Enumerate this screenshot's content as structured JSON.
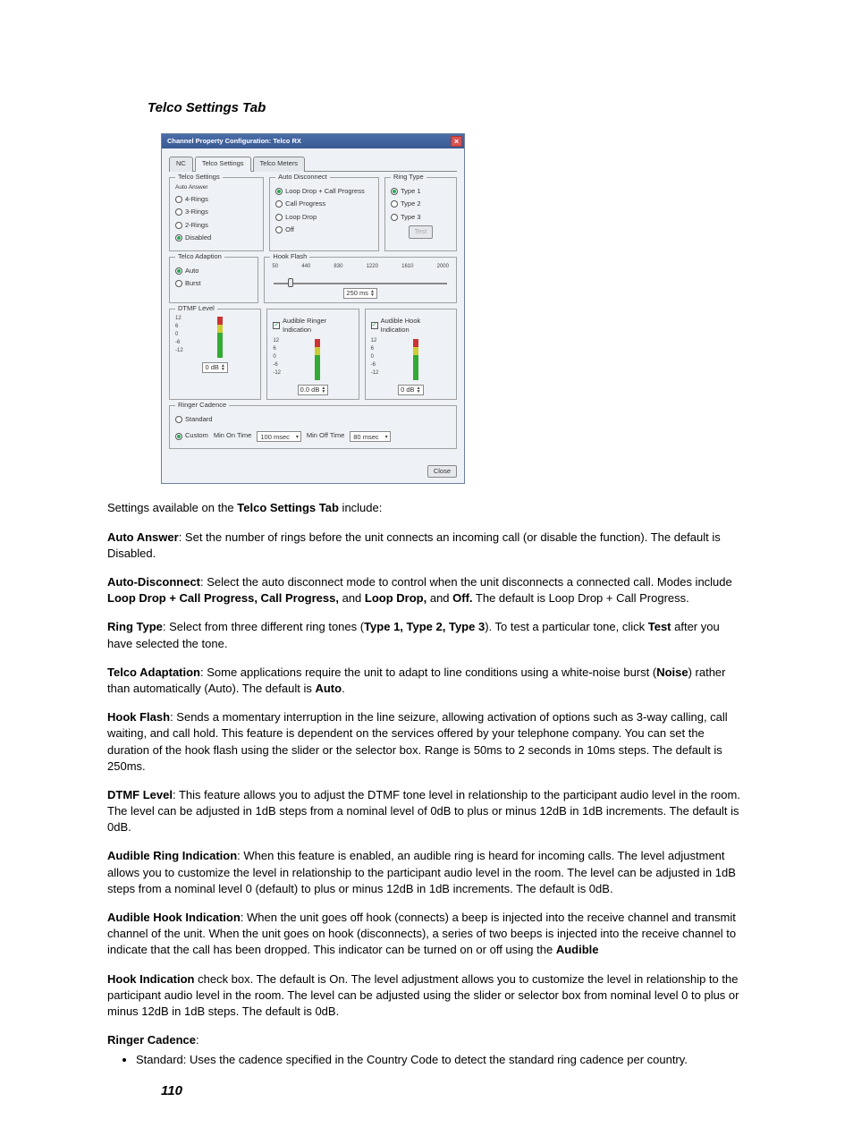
{
  "section_title": "Telco Settings Tab",
  "dialog": {
    "title": "Channel Property Configuration: Telco RX",
    "close": "×",
    "tabs": [
      {
        "label": "NC"
      },
      {
        "label": "Telco Settings"
      },
      {
        "label": "Telco Meters"
      }
    ],
    "groups": {
      "telco_settings": "Telco Settings",
      "auto_answer": "Auto Answer",
      "auto_disconnect": "Auto Disconnect",
      "ring_type": "Ring Type",
      "telco_adaption": "Telco Adaption",
      "hook_flash": "Hook Flash",
      "dtmf_level": "DTMF Level",
      "ringer_cadence": "Ringer Cadence"
    },
    "auto_answer_opts": [
      "4-Rings",
      "3-Rings",
      "2-Rings",
      "Disabled"
    ],
    "auto_disconnect_opts": [
      "Loop Drop + Call Progress",
      "Call Progress",
      "Loop Drop",
      "Off"
    ],
    "ring_type_opts": [
      "Type 1",
      "Type 2",
      "Type 3"
    ],
    "btn_test": "Test",
    "telco_adaption_opts": [
      "Auto",
      "Burst"
    ],
    "hook_flash": {
      "ticks": [
        "50",
        "440",
        "830",
        "1220",
        "1610",
        "2000"
      ],
      "value": "250 ms"
    },
    "audible_ring_label": "Audible Ringer Indication",
    "audible_hook_label": "Audible Hook Indication",
    "meter_ticks": [
      "12",
      "6",
      "0",
      "-6",
      "-12"
    ],
    "dtmf_db": "0 dB",
    "ring_db": "0.0 dB",
    "hook_db": "0 dB",
    "cadence_opts": [
      "Standard",
      "Custom"
    ],
    "min_on_label": "Min On Time",
    "min_on_value": "100 msec",
    "min_off_label": "Min Off Time",
    "min_off_value": "80 msec",
    "btn_close": "Close"
  },
  "intro": "Settings available on the ",
  "intro_bold": "Telco Settings Tab",
  "intro_tail": " include:",
  "paras": {
    "auto_answer": {
      "label": "Auto Answer",
      "text": ": Set the number of rings before the unit connects an incoming call (or disable the function). The default is Disabled."
    },
    "auto_disconnect": {
      "label": "Auto-Disconnect",
      "pre": ": Select the auto disconnect mode to control when the unit disconnects a connected call. Modes include ",
      "b1": "Loop Drop + Call Progress, Call Progress,",
      "mid1": " and ",
      "b2": "Loop Drop,",
      "mid2": " and ",
      "b3": "Off.",
      "tail": " The default is Loop Drop + Call Progress."
    },
    "ring_type": {
      "label": "Ring Type",
      "pre": ": Select from three different ring tones (",
      "b1": "Type 1, Type 2, Type 3",
      "mid": "). To test a particular tone, click ",
      "b2": "Test",
      "tail": " after you have selected the tone."
    },
    "telco_adapt": {
      "label": "Telco Adaptation",
      "pre": ": Some applications require the unit to adapt to line conditions using a white-noise burst (",
      "b1": "Noise",
      "mid": ") rather than automatically (Auto). The default is ",
      "b2": "Auto",
      "tail": "."
    },
    "hook_flash": {
      "label": "Hook Flash",
      "text": ": Sends a momentary interruption in the line seizure, allowing activation of options such as 3-way calling, call waiting, and call hold. This feature is dependent on the services offered by your telephone company. You can set the duration of the hook flash using the slider or the selector box. Range is 50ms to 2 seconds in 10ms steps. The default is 250ms."
    },
    "dtmf": {
      "label": "DTMF Level",
      "text": ": This feature allows you to adjust the DTMF tone level in relationship to the participant audio level in the room. The level can be adjusted in 1dB steps from a nominal level of 0dB to plus or minus 12dB in 1dB increments. The default is 0dB."
    },
    "aring": {
      "label": "Audible Ring Indication",
      "text": ": When this feature is enabled, an audible ring is heard for incoming calls. The level adjustment allows you to customize the level in relationship to the participant audio level in the room. The level can be adjusted in 1dB steps from a nominal level 0 (default) to plus or minus 12dB in 1dB increments. The default is 0dB."
    },
    "ahook": {
      "label": "Audible Hook Indication",
      "pre": ": When the unit goes off hook (connects) a beep is injected into the receive channel and transmit channel of the unit. When the unit goes on hook (disconnects), a series of two beeps is injected into the receive channel to indicate that the call has been dropped. This indicator can be turned on or off using the ",
      "b1": "Audible"
    },
    "hookind": {
      "label": "Hook Indication",
      "text": " check box. The default is On. The level adjustment allows you to customize the level in relationship to the participant audio level in the room. The level can be adjusted using the slider or selector box from nominal level 0 to plus or minus 12dB in 1dB steps. The default is 0dB."
    },
    "ringer_cadence": {
      "label": "Ringer Cadence",
      "tail": ":"
    },
    "bullet_std": "Standard: Uses the cadence specified in the Country Code to detect the standard ring cadence per country."
  },
  "page_number": "110"
}
